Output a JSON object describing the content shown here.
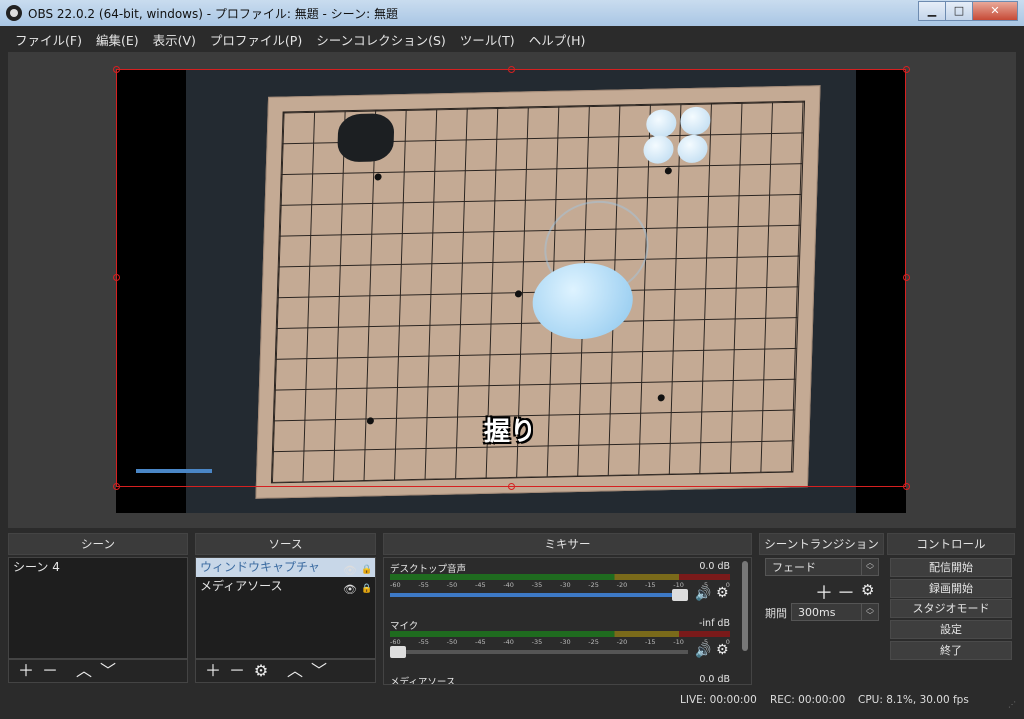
{
  "window": {
    "title": "OBS 22.0.2 (64-bit, windows) - プロファイル: 無題 - シーン: 無題",
    "min_label": "▁",
    "max_label": "□",
    "close_label": "✕"
  },
  "menu": [
    "ファイル(F)",
    "編集(E)",
    "表示(V)",
    "プロファイル(P)",
    "シーンコレクション(S)",
    "ツール(T)",
    "ヘルプ(H)"
  ],
  "preview": {
    "caption": "握り"
  },
  "docks": {
    "scenes": {
      "header": "シーン",
      "items": [
        "シーン 4"
      ]
    },
    "sources": {
      "header": "ソース",
      "items": [
        "ウィンドウキャプチャ",
        "メディアソース"
      ]
    },
    "mixer": {
      "header": "ミキサー",
      "ticks": [
        "-60",
        "-55",
        "-50",
        "-45",
        "-40",
        "-35",
        "-30",
        "-25",
        "-20",
        "-15",
        "-10",
        "-5",
        "0"
      ],
      "channels": [
        {
          "name": "デスクトップ音声",
          "db": "0.0 dB",
          "volume": 1.0
        },
        {
          "name": "マイク",
          "db": "-inf dB",
          "volume": 0.0
        },
        {
          "name": "メディアソース",
          "db": "0.0 dB"
        }
      ]
    },
    "transitions": {
      "header": "シーントランジション",
      "selected": "フェード",
      "duration_label": "期間",
      "duration_value": "300ms"
    },
    "controls": {
      "header": "コントロール",
      "buttons": [
        "配信開始",
        "録画開始",
        "スタジオモード",
        "設定",
        "終了"
      ]
    }
  },
  "status": {
    "live": "LIVE: 00:00:00",
    "rec": "REC: 00:00:00",
    "cpu": "CPU: 8.1%, 30.00 fps"
  },
  "colors": {
    "accent": "#3d79c6",
    "selection": "#d62020"
  }
}
